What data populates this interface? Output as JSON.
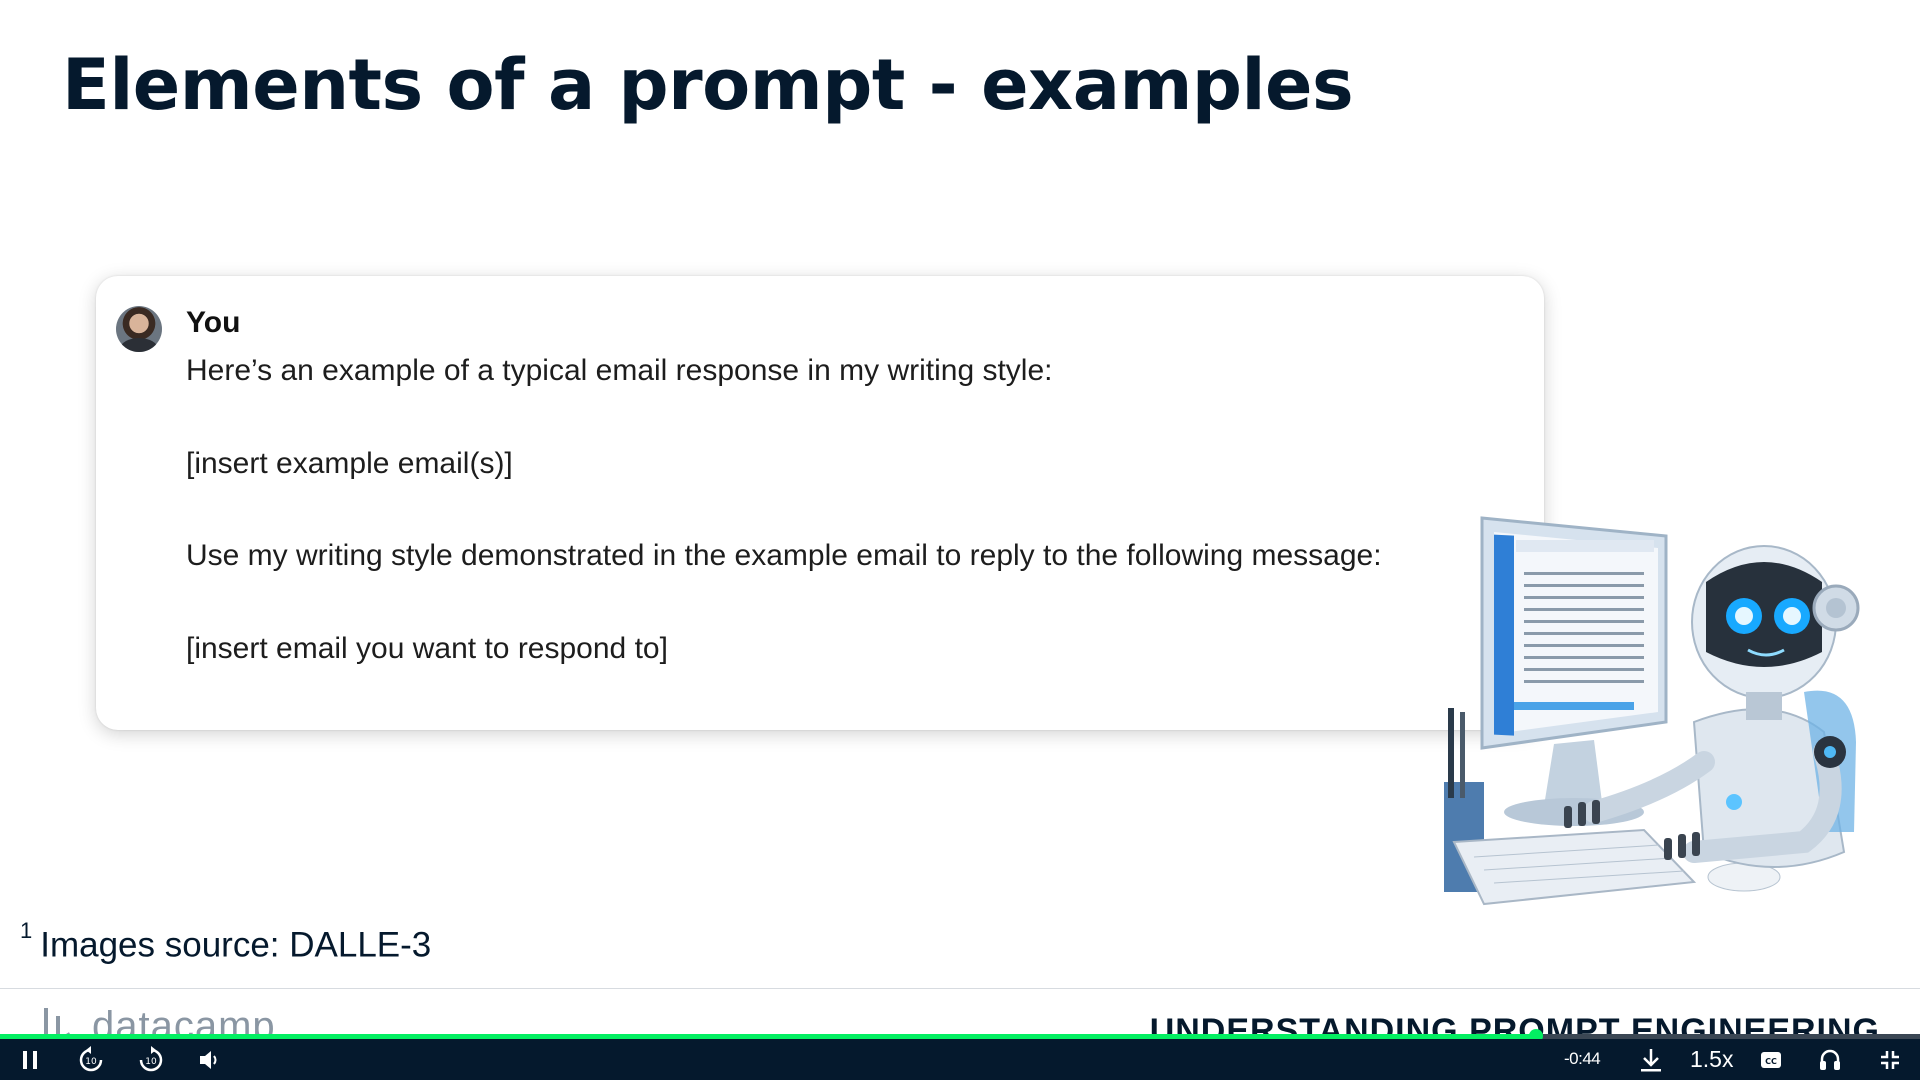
{
  "slide": {
    "title": "Elements of a prompt - examples"
  },
  "chat": {
    "sender": "You",
    "lines": [
      "Here’s an example of a typical email response in my writing style:",
      "[insert example email(s)]",
      "Use my writing style demonstrated in the example email to reply to the following message:",
      "[insert email you want to respond to]"
    ]
  },
  "footnote": {
    "marker": "1",
    "text": "Images source: DALLE-3"
  },
  "footer": {
    "brand": "datacamp",
    "course_title": "UNDERSTANDING PROMPT ENGINEERING"
  },
  "player": {
    "time_remaining": "-0:44",
    "playback_speed": "1.5x",
    "progress_fraction": 0.8,
    "accent_color": "#03ef62",
    "bar_color": "#05192d",
    "icons": [
      "pause-icon",
      "rewind-10-icon",
      "forward-10-icon",
      "volume-icon",
      "download-icon",
      "captions-icon",
      "audio-icon",
      "exit-fullscreen-icon"
    ]
  }
}
